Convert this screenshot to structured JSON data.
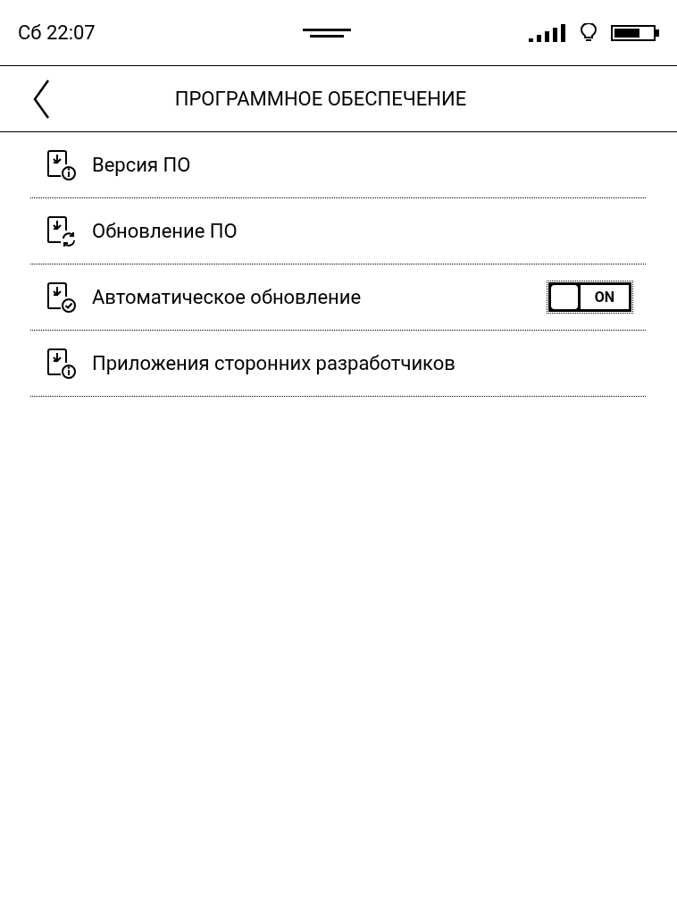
{
  "status_bar": {
    "time": "Сб 22:07"
  },
  "header": {
    "title": "ПРОГРАММНОЕ ОБЕСПЕЧЕНИЕ"
  },
  "items": [
    {
      "label": "Версия ПО"
    },
    {
      "label": "Обновление ПО"
    },
    {
      "label": "Автоматическое обновление",
      "toggle": {
        "on": true,
        "label": "ON"
      }
    },
    {
      "label": "Приложения сторонних разработчиков"
    }
  ]
}
